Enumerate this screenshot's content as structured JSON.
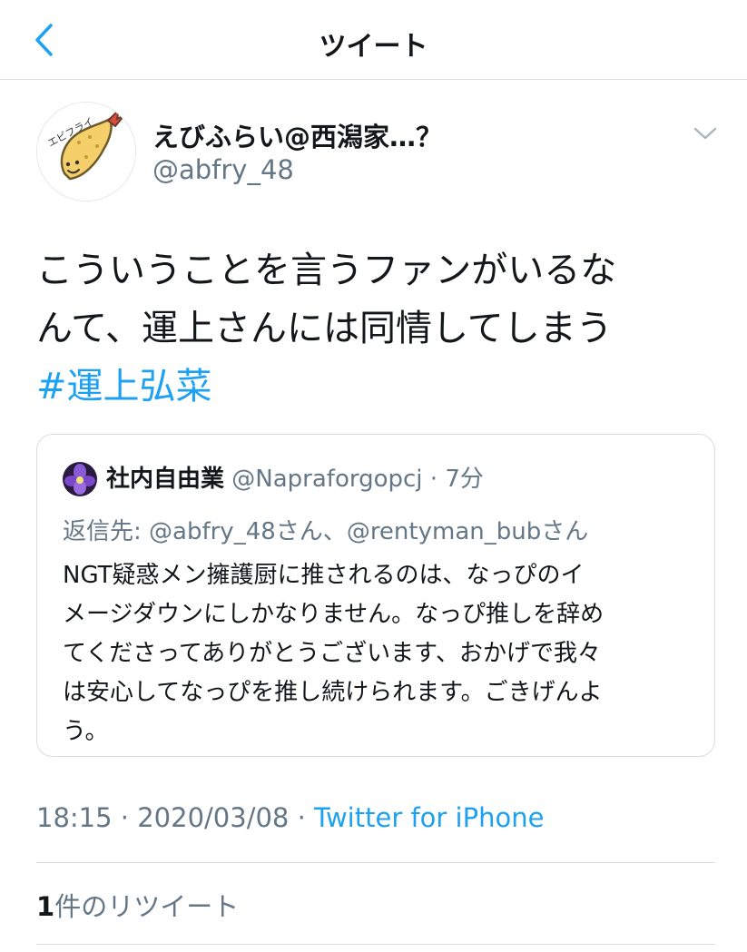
{
  "header": {
    "title": "ツイート",
    "back_icon": "chevron-left-icon",
    "accent_color": "#1da1f2"
  },
  "tweet": {
    "display_name": "えびふらい@西潟家…？",
    "handle": "@abfry_48",
    "avatar_icon": "fried-shrimp-avatar",
    "avatar_text": "エビフライ",
    "text_lines": [
      "こういうことを言うファンがいるな",
      "んて、運上さんには同情してしまう"
    ],
    "hashtag": "#運上弘菜",
    "time": "18:15",
    "date": "2020/03/08",
    "separator": "·",
    "source": "Twitter for iPhone"
  },
  "quoted_tweet": {
    "display_name": "社内自由業",
    "handle": "@Napraforgopcj",
    "separator": "·",
    "time_ago": "7分",
    "avatar_icon": "purple-flower-avatar",
    "reply_prefix": "返信先: ",
    "reply_to_1": "@abfry_48さん",
    "reply_sep": "、",
    "reply_to_2": "@rentyman_bubさん",
    "text_lines": [
      "NGT疑惑メン擁護厨に推されるのは、なっぴのイ",
      "メージダウンにしかなりません。なっぴ推しを辞め",
      "てくださってありがとうございます、おかげで我々",
      "は安心してなっぴを推し続けられます。ごきげんよ",
      "う。"
    ]
  },
  "stats": {
    "retweet_count": "1",
    "retweet_label": "件のリツイート"
  }
}
